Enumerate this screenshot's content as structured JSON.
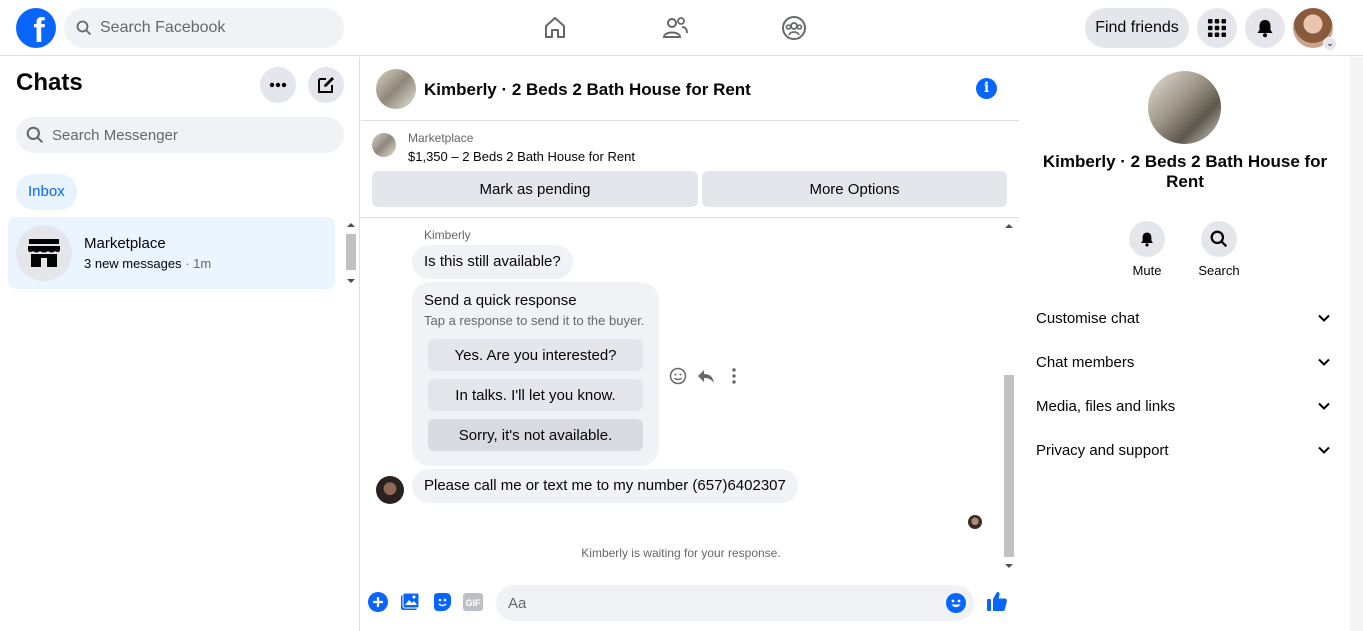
{
  "topbar": {
    "logo": "f",
    "search_placeholder": "Search Facebook",
    "nav_icons": [
      "home-icon",
      "friends-icon",
      "groups-icon"
    ],
    "find_friends": "Find friends",
    "accent": "#0866ff"
  },
  "sidebar": {
    "title": "Chats",
    "search_placeholder": "Search Messenger",
    "filter": "Inbox",
    "chats": [
      {
        "name": "Marketplace",
        "preview": "3 new messages",
        "time": "· 1m"
      }
    ]
  },
  "conversation": {
    "title": "Kimberly · 2 Beds 2 Bath House for Rent",
    "marketplace_label": "Marketplace",
    "listing": "$1,350 – 2 Beds 2 Bath House for Rent",
    "mark_pending": "Mark as pending",
    "more_options": "More Options",
    "sender_name": "Kimberly",
    "message1": "Is this still available?",
    "quick_response": {
      "heading": "Send a quick response",
      "subtext": "Tap a response to send it to the buyer.",
      "options": [
        "Yes. Are you interested?",
        "In talks. I'll let you know.",
        "Sorry, it's not available."
      ]
    },
    "message2": "Please call me or text me to my number (657)6402307",
    "waiting_text": "Kimberly is waiting for your response.",
    "composer_placeholder": "Aa"
  },
  "details": {
    "name": "Kimberly · 2 Beds 2 Bath House for Rent",
    "actions": [
      {
        "label": "Mute",
        "icon": "bell-icon"
      },
      {
        "label": "Search",
        "icon": "search-icon"
      }
    ],
    "sections": [
      "Customise chat",
      "Chat members",
      "Media, files and links",
      "Privacy and support"
    ]
  }
}
